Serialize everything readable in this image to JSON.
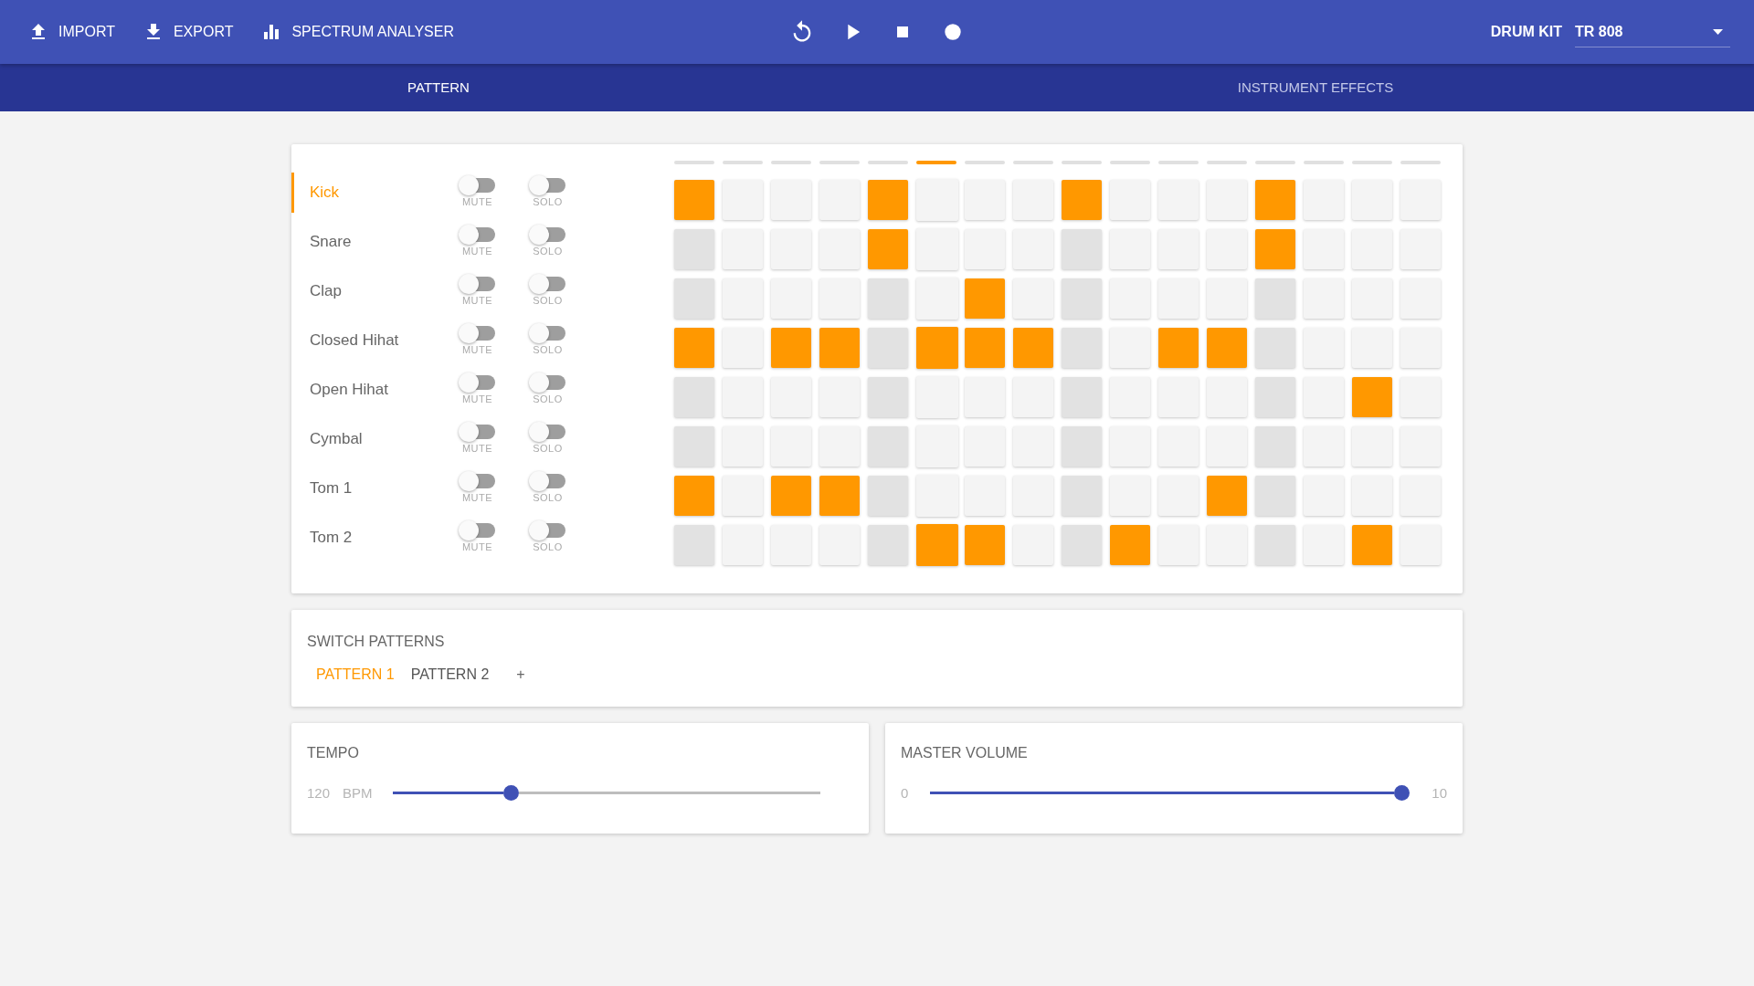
{
  "toolbar": {
    "actions": [
      {
        "label": "IMPORT",
        "kind": "import"
      },
      {
        "label": "EXPORT",
        "kind": "export"
      },
      {
        "label": "SPECTRUM ANALYSER",
        "kind": "spectrum"
      }
    ],
    "transport": [
      {
        "kind": "rewind"
      },
      {
        "kind": "play"
      },
      {
        "kind": "stop"
      },
      {
        "kind": "record"
      }
    ],
    "drum_kit": {
      "label": "DRUM KIT",
      "value": "TR 808"
    }
  },
  "tabs": [
    {
      "label": "PATTERN",
      "selected": true
    },
    {
      "label": "INSTRUMENT EFFECTS",
      "selected": false
    }
  ],
  "sequencer": {
    "step_markers": [
      {
        "selected": false
      },
      {
        "selected": false
      },
      {
        "selected": false
      },
      {
        "selected": false
      },
      {
        "selected": false
      },
      {
        "selected": true
      },
      {
        "selected": false
      },
      {
        "selected": false
      },
      {
        "selected": false
      },
      {
        "selected": false
      },
      {
        "selected": false
      },
      {
        "selected": false
      },
      {
        "selected": false
      },
      {
        "selected": false
      },
      {
        "selected": false
      },
      {
        "selected": false
      }
    ],
    "instruments": [
      {
        "name": "Kick",
        "selected": true,
        "muted": false,
        "mute_label": "MUTE",
        "solo": false,
        "solo_label": "SOLO",
        "steps": [
          true,
          false,
          false,
          false,
          true,
          false,
          false,
          false,
          true,
          false,
          false,
          false,
          true,
          false,
          false,
          false
        ]
      },
      {
        "name": "Snare",
        "selected": false,
        "muted": false,
        "mute_label": "MUTE",
        "solo": false,
        "solo_label": "SOLO",
        "steps": [
          false,
          false,
          false,
          false,
          true,
          false,
          false,
          false,
          false,
          false,
          false,
          false,
          true,
          false,
          false,
          false
        ]
      },
      {
        "name": "Clap",
        "selected": false,
        "muted": false,
        "mute_label": "MUTE",
        "solo": false,
        "solo_label": "SOLO",
        "steps": [
          false,
          false,
          false,
          false,
          false,
          false,
          true,
          false,
          false,
          false,
          false,
          false,
          false,
          false,
          false,
          false
        ]
      },
      {
        "name": "Closed Hihat",
        "selected": false,
        "muted": false,
        "mute_label": "MUTE",
        "solo": false,
        "solo_label": "SOLO",
        "steps": [
          true,
          false,
          true,
          true,
          false,
          true,
          true,
          true,
          false,
          false,
          true,
          true,
          false,
          false,
          false,
          false
        ]
      },
      {
        "name": "Open Hihat",
        "selected": false,
        "muted": false,
        "mute_label": "MUTE",
        "solo": false,
        "solo_label": "SOLO",
        "steps": [
          false,
          false,
          false,
          false,
          false,
          false,
          false,
          false,
          false,
          false,
          false,
          false,
          false,
          false,
          true,
          false
        ]
      },
      {
        "name": "Cymbal",
        "selected": false,
        "muted": false,
        "mute_label": "MUTE",
        "solo": false,
        "solo_label": "SOLO",
        "steps": [
          false,
          false,
          false,
          false,
          false,
          false,
          false,
          false,
          false,
          false,
          false,
          false,
          false,
          false,
          false,
          false
        ]
      },
      {
        "name": "Tom 1",
        "selected": false,
        "muted": false,
        "mute_label": "MUTE",
        "solo": false,
        "solo_label": "SOLO",
        "steps": [
          true,
          false,
          true,
          true,
          false,
          false,
          false,
          false,
          false,
          false,
          false,
          true,
          false,
          false,
          false,
          false
        ]
      },
      {
        "name": "Tom 2",
        "selected": false,
        "muted": false,
        "mute_label": "MUTE",
        "solo": false,
        "solo_label": "SOLO",
        "steps": [
          false,
          false,
          false,
          false,
          false,
          true,
          true,
          false,
          false,
          true,
          false,
          false,
          false,
          false,
          true,
          false
        ]
      }
    ]
  },
  "patterns": {
    "title": "SWITCH PATTERNS",
    "items": [
      {
        "label": "PATTERN 1",
        "selected": true
      },
      {
        "label": "PATTERN 2",
        "selected": false
      }
    ],
    "add": "+"
  },
  "tempo": {
    "title": "TEMPO",
    "value": "120",
    "unit": "BPM",
    "level": 0.27
  },
  "master_volume": {
    "title": "MASTER VOLUME",
    "min": "0",
    "max": "10",
    "level": 1
  }
}
